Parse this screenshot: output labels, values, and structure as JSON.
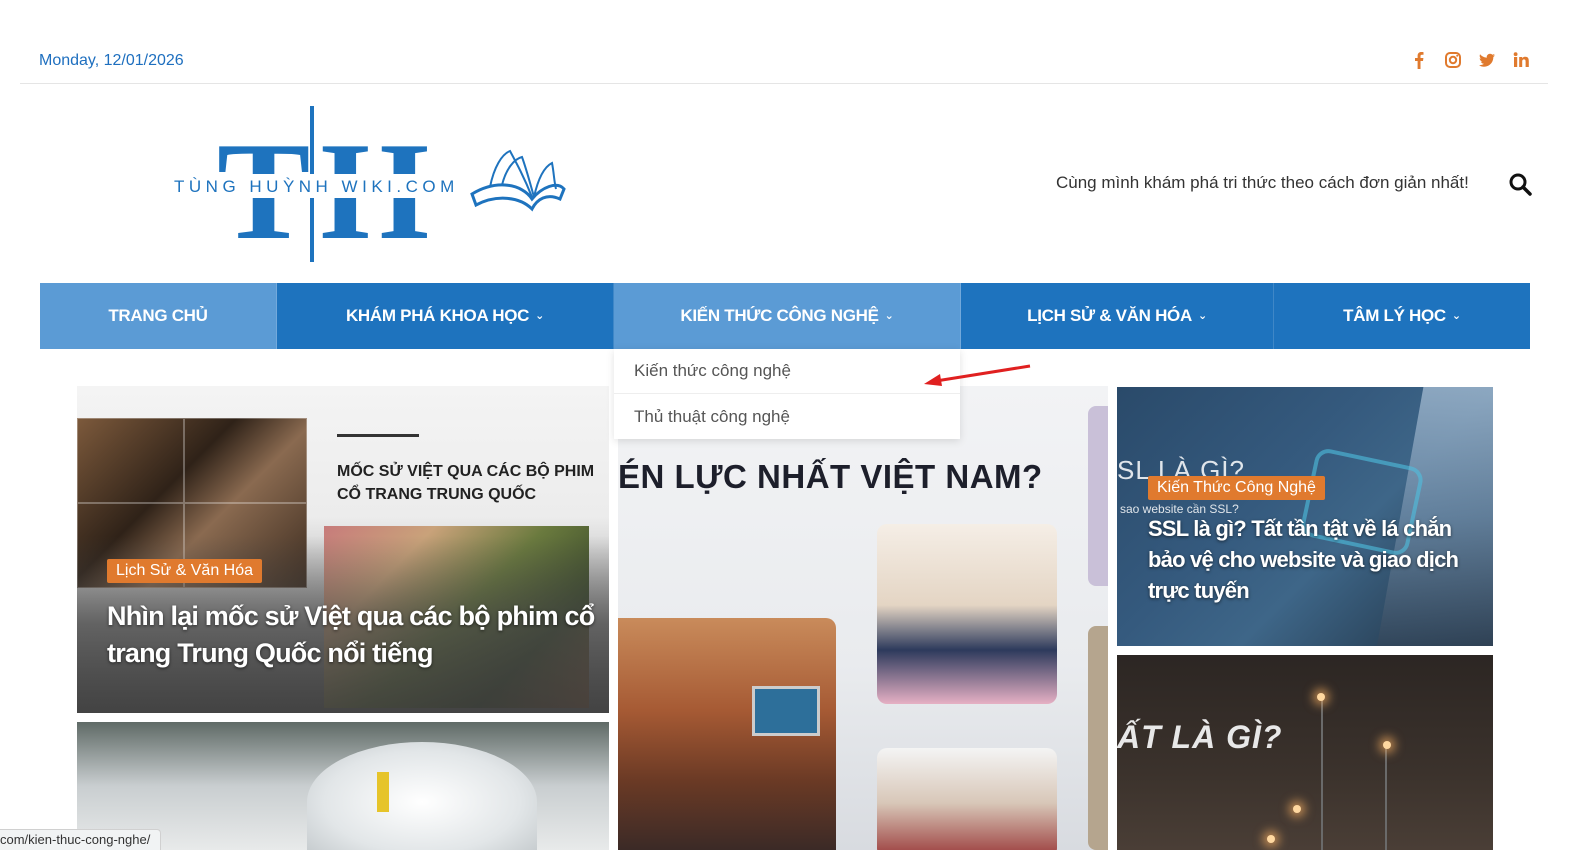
{
  "topbar": {
    "date": "Monday, 12/01/2026",
    "social": [
      "facebook-icon",
      "instagram-icon",
      "twitter-icon",
      "linkedin-icon"
    ]
  },
  "header": {
    "logo_letters": "TH",
    "logo_text": "TÙNG HUỲNH WIKI.COM",
    "tagline": "Cùng mình khám phá tri thức theo cách đơn giản nhất!"
  },
  "nav": {
    "items": [
      {
        "label": "TRANG CHỦ",
        "has_dropdown": false
      },
      {
        "label": "KHÁM PHÁ KHOA HỌC",
        "has_dropdown": true
      },
      {
        "label": "KIẾN THỨC CÔNG NGHỆ",
        "has_dropdown": true
      },
      {
        "label": "LỊCH SỬ & VĂN HÓA",
        "has_dropdown": true
      },
      {
        "label": "TÂM LÝ HỌC",
        "has_dropdown": true
      }
    ],
    "dropdown": [
      "Kiến thức công nghệ",
      "Thủ thuật công nghệ"
    ]
  },
  "cards": {
    "card1": {
      "image_heading": "MỐC SỬ VIỆT QUA CÁC BỘ PHIM CỔ TRANG TRUNG QUỐC",
      "category": "Lịch Sử & Văn Hóa",
      "title": "Nhìn lại mốc sử Việt qua các bộ phim cổ trang Trung Quốc nổi tiếng"
    },
    "card3": {
      "image_heading": "ÉN LỰC NHẤT VIỆT NAM?"
    },
    "card4": {
      "image_heading": "SL LÀ GÌ?",
      "image_sub": "sao website cần SSL?",
      "category": "Kiến Thức Công Nghệ",
      "title": "SSL là gì? Tất tần tật về lá chắn bảo vệ cho website và giao dịch trực tuyến"
    },
    "card5": {
      "image_heading": "ẤT LÀ GÌ?"
    }
  },
  "statusbar": {
    "url": "com/kien-thuc-cong-nghe/"
  },
  "colors": {
    "brand_blue": "#1e73be",
    "nav_active": "#5b9bd5",
    "accent_orange": "#e07a2e"
  }
}
